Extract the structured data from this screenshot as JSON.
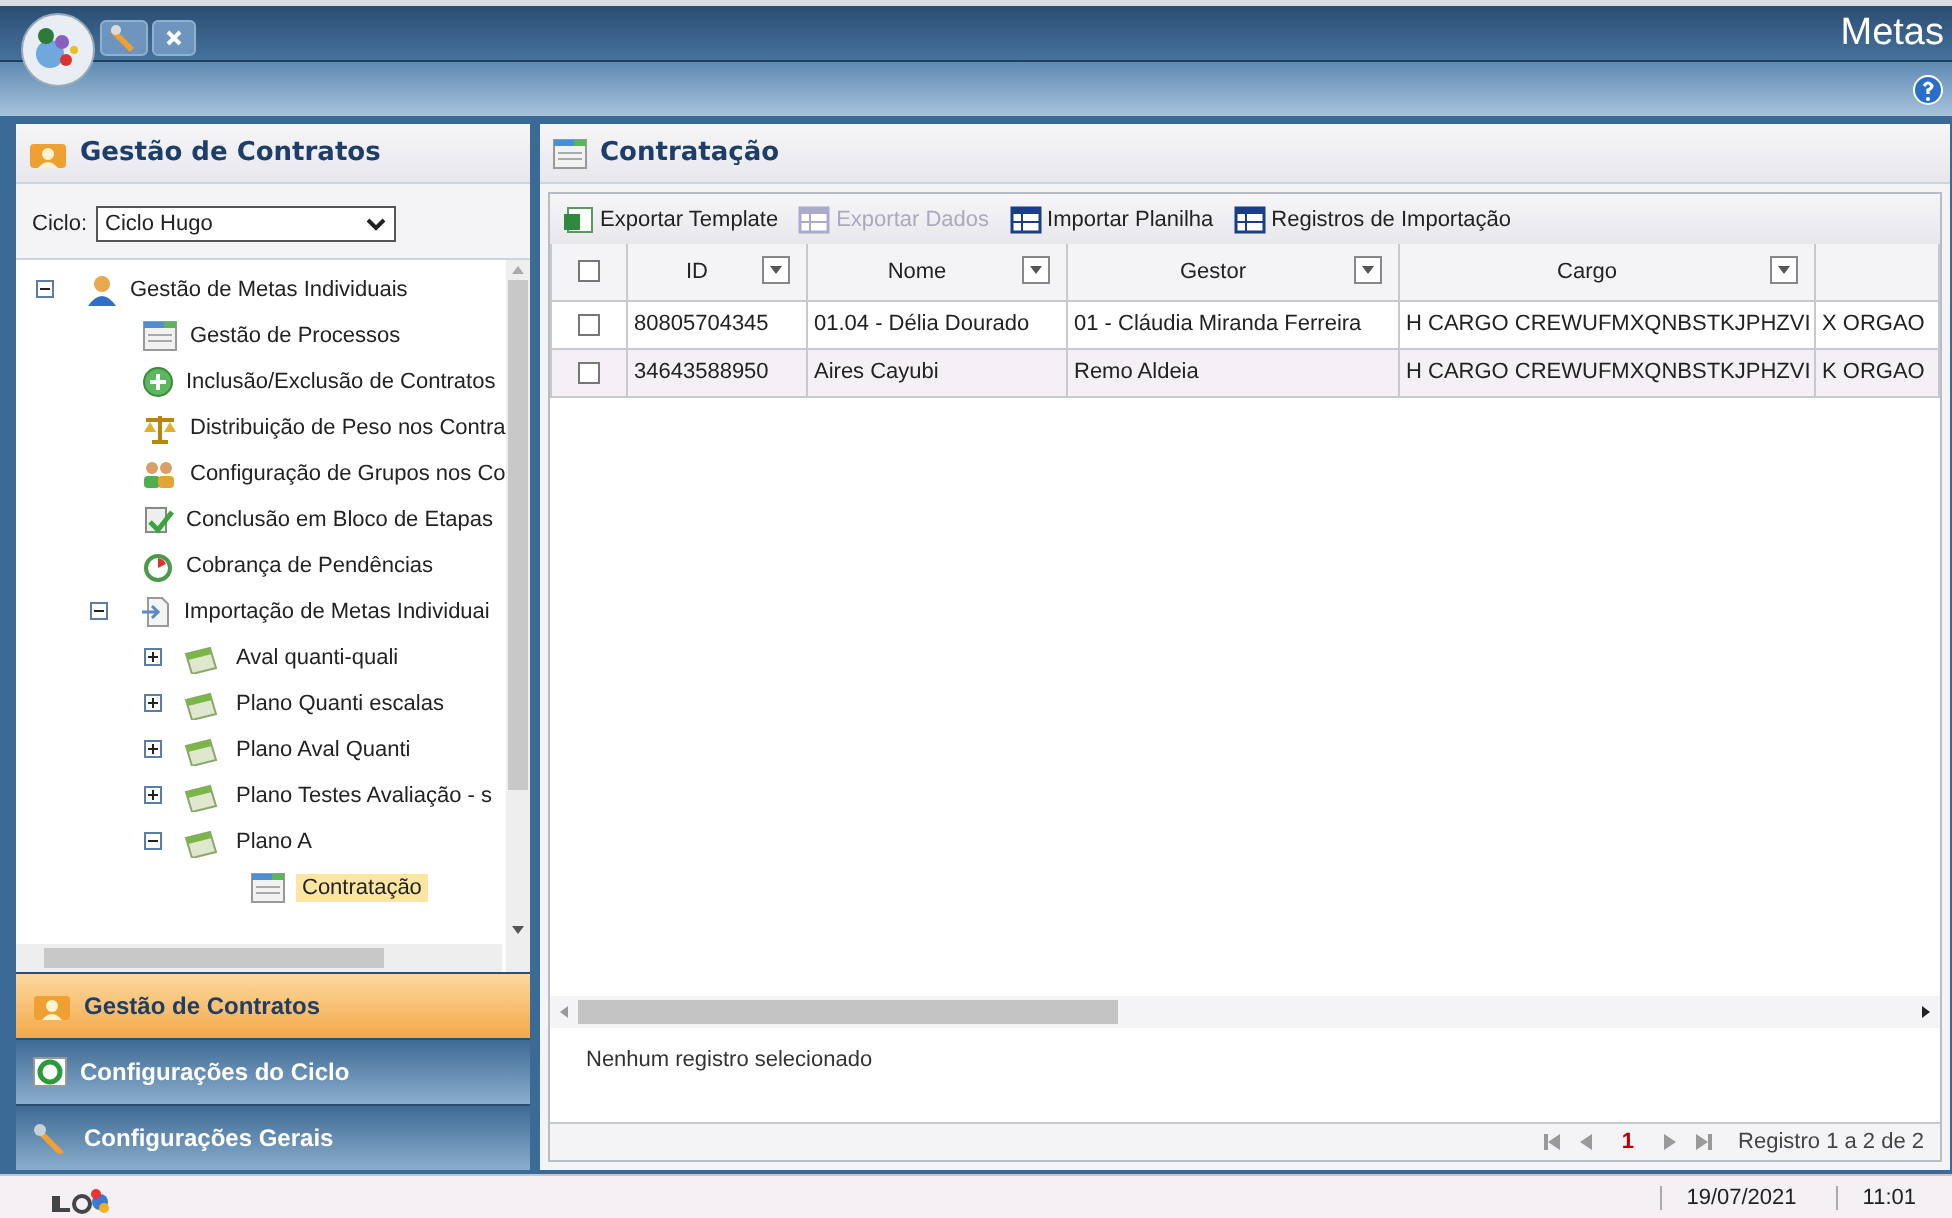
{
  "app": {
    "title": "Metas"
  },
  "sidebar": {
    "title": "Gestão de Contratos",
    "cycle": {
      "label": "Ciclo:",
      "value": "Ciclo Hugo"
    },
    "tree": [
      {
        "label": "Gestão de Metas Individuais",
        "kind": "group",
        "expanded": true,
        "selected": false,
        "children": [
          {
            "label": "Gestão de Processos",
            "kind": "task",
            "selected": false
          },
          {
            "label": "Inclusão/Exclusão de Contratos",
            "kind": "task",
            "selected": false
          },
          {
            "label": "Distribuição de Peso nos Contra",
            "kind": "task",
            "selected": false
          },
          {
            "label": "Configuração de Grupos nos Co",
            "kind": "task",
            "selected": false
          },
          {
            "label": "Conclusão em Bloco de Etapas",
            "kind": "task",
            "selected": false
          },
          {
            "label": "Cobrança de Pendências",
            "kind": "task",
            "selected": false
          },
          {
            "label": "Importação de Metas Individuai",
            "kind": "import",
            "expanded": true,
            "selected": false,
            "children": [
              {
                "label": "Aval quanti-quali",
                "kind": "plan",
                "expanded": false,
                "selected": false
              },
              {
                "label": "Plano Quanti escalas",
                "kind": "plan",
                "expanded": false,
                "selected": false
              },
              {
                "label": "Plano Aval Quanti",
                "kind": "plan",
                "expanded": false,
                "selected": false
              },
              {
                "label": "Plano Testes Avaliação - s",
                "kind": "plan",
                "expanded": false,
                "selected": false
              },
              {
                "label": "Plano A",
                "kind": "plan",
                "expanded": true,
                "selected": false,
                "children": [
                  {
                    "label": "Contratação",
                    "kind": "screen",
                    "selected": true
                  }
                ]
              }
            ]
          }
        ]
      }
    ],
    "sections": [
      {
        "label": "Gestão de Contratos",
        "selected": true
      },
      {
        "label": "Configurações do Ciclo",
        "selected": false
      },
      {
        "label": "Configurações Gerais",
        "selected": false
      }
    ]
  },
  "content": {
    "title": "Contratação",
    "toolbar": [
      {
        "label": "Exportar Template",
        "kind": "excel",
        "disabled": false
      },
      {
        "label": "Exportar Dados",
        "kind": "grid",
        "disabled": true
      },
      {
        "label": "Importar Planilha",
        "kind": "grid",
        "disabled": false
      },
      {
        "label": "Registros de Importação",
        "kind": "grid",
        "disabled": false
      }
    ],
    "table": {
      "all_checked": false,
      "columns": [
        "ID",
        "Nome",
        "Gestor",
        "Cargo"
      ],
      "rows": [
        {
          "checked": false,
          "cells": [
            "80805704345",
            "01.04 - Délia Dourado",
            "01 - Cláudia Miranda Ferreira",
            "H CARGO CREWUFMXQNBSTKJPHZVI",
            "X ORGAO"
          ]
        },
        {
          "checked": false,
          "cells": [
            "34643588950",
            "Aires Cayubi",
            "Remo Aldeia",
            "H CARGO CREWUFMXQNBSTKJPHZVI",
            "K ORGAO"
          ]
        }
      ]
    },
    "selection_status": "Nenhum registro selecionado",
    "pager": {
      "page": "1",
      "summary": "Registro 1 a 2 de 2"
    }
  },
  "status_bar": {
    "date": "19/07/2021",
    "time": "11:01"
  }
}
